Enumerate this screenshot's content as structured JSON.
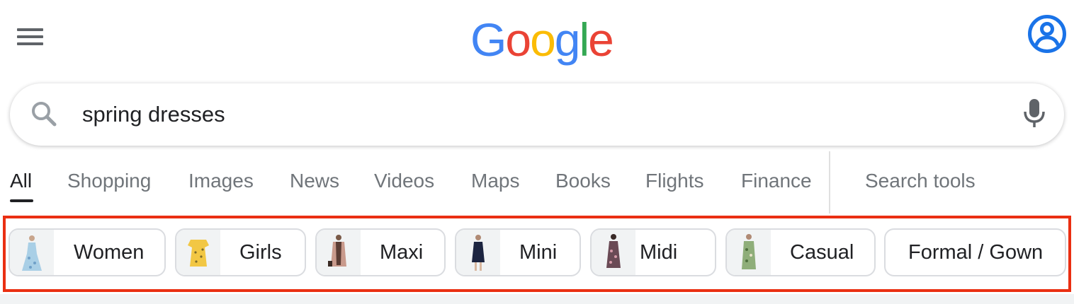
{
  "header": {
    "logo_letters": [
      {
        "ch": "G",
        "color": "#4285f4"
      },
      {
        "ch": "o",
        "color": "#ea4335"
      },
      {
        "ch": "o",
        "color": "#fbbc05"
      },
      {
        "ch": "g",
        "color": "#4285f4"
      },
      {
        "ch": "l",
        "color": "#34a853"
      },
      {
        "ch": "e",
        "color": "#ea4335"
      }
    ],
    "menu_icon": "hamburger-menu-icon",
    "account_icon": "account-circle-icon",
    "account_color": "#1a73e8"
  },
  "search": {
    "query": "spring dresses",
    "search_icon": "search-icon",
    "mic_icon": "microphone-icon"
  },
  "tabs": [
    {
      "label": "All",
      "active": true
    },
    {
      "label": "Shopping"
    },
    {
      "label": "Images"
    },
    {
      "label": "News"
    },
    {
      "label": "Videos"
    },
    {
      "label": "Maps"
    },
    {
      "label": "Books"
    },
    {
      "label": "Flights"
    },
    {
      "label": "Finance"
    }
  ],
  "search_tools_label": "Search tools",
  "chips": [
    {
      "label": "Women",
      "thumb": "floral-maxi-dress",
      "dress_color": "#a9cfe6"
    },
    {
      "label": "Girls",
      "thumb": "yellow-girls-dress",
      "dress_color": "#f2c744"
    },
    {
      "label": "Maxi",
      "thumb": "pink-cardigan-maxi",
      "dress_color": "#c99a8c"
    },
    {
      "label": "Mini",
      "thumb": "navy-mini-dress",
      "dress_color": "#1c2440"
    },
    {
      "label": "Midi",
      "thumb": "dark-floral-midi",
      "dress_color": "#6a4a55"
    },
    {
      "label": "Casual",
      "thumb": "green-floral-casual",
      "dress_color": "#8fae7a"
    },
    {
      "label": "Formal / Gown"
    }
  ],
  "highlight_color": "#ea2f12"
}
